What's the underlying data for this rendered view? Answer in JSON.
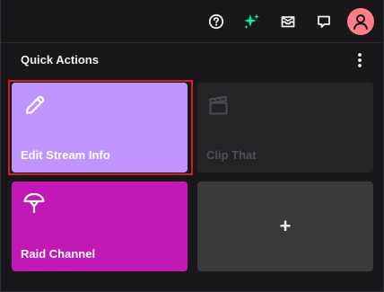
{
  "colors": {
    "background": "#18181b",
    "accent_green": "#00f593",
    "avatar": "#ff7c88",
    "edit_tile": "#bf94ff",
    "raid_tile": "#c218b5",
    "disabled_tile": "#242427",
    "add_tile": "#3a3a3d",
    "focus_outline": "#d11f1f"
  },
  "topbar": {
    "icons": [
      "help-icon",
      "sparkle-icon",
      "inbox-icon",
      "whispers-icon",
      "user-avatar-icon"
    ]
  },
  "panel": {
    "title": "Quick Actions",
    "menu_icon": "vertical-dots-icon"
  },
  "tiles": [
    {
      "label": "Edit Stream Info",
      "icon": "pencil-icon",
      "enabled": true,
      "focused": true
    },
    {
      "label": "Clip That",
      "icon": "clapperboard-icon",
      "enabled": false
    },
    {
      "label": "Raid Channel",
      "icon": "raid-icon",
      "enabled": true
    },
    {
      "label": "+",
      "icon": "plus-icon",
      "enabled": true
    }
  ]
}
